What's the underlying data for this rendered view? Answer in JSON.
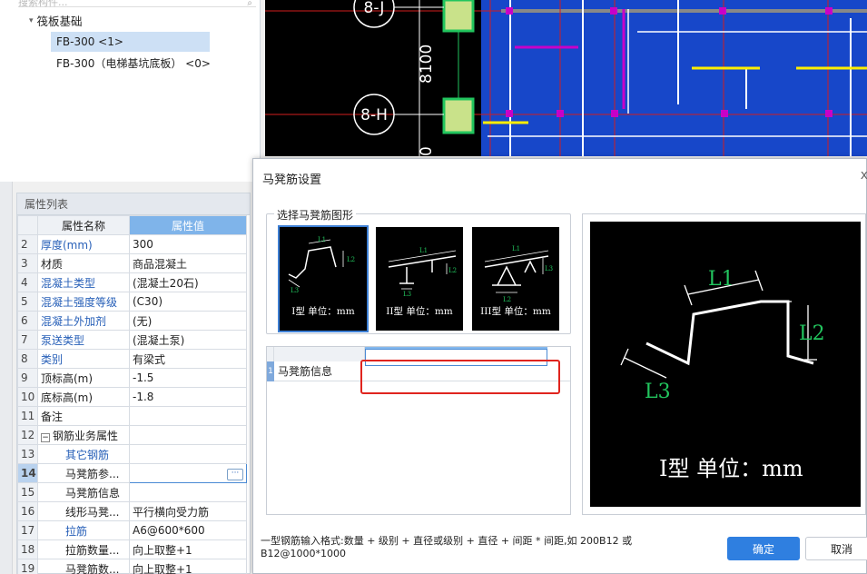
{
  "tree": {
    "search_placeholder": "搜索构件...",
    "root_label": "筏板基础",
    "nodes": [
      "FB-300 <1>",
      "FB-300（电梯基坑底板） <0>"
    ]
  },
  "props": {
    "panel_title": "属性列表",
    "col_name": "属性名称",
    "col_value": "属性值",
    "rows": [
      {
        "n": "2",
        "name": "厚度(mm)",
        "value": "300"
      },
      {
        "n": "3",
        "name": "材质",
        "value": "商品混凝土"
      },
      {
        "n": "4",
        "name": "混凝土类型",
        "value": "(混凝土20石)"
      },
      {
        "n": "5",
        "name": "混凝土强度等级",
        "value": "(C30)"
      },
      {
        "n": "6",
        "name": "混凝土外加剂",
        "value": "(无)"
      },
      {
        "n": "7",
        "name": "泵送类型",
        "value": "(混凝土泵)"
      },
      {
        "n": "8",
        "name": "类别",
        "value": "有梁式"
      },
      {
        "n": "9",
        "name": "顶标高(m)",
        "value": "-1.5"
      },
      {
        "n": "10",
        "name": "底标高(m)",
        "value": "-1.8"
      },
      {
        "n": "11",
        "name": "备注",
        "value": ""
      },
      {
        "n": "12",
        "name": "钢筋业务属性",
        "value": ""
      },
      {
        "n": "13",
        "name": "其它钢筋",
        "value": ""
      },
      {
        "n": "14",
        "name": "马凳筋参...",
        "value": ""
      },
      {
        "n": "15",
        "name": "马凳筋信息",
        "value": ""
      },
      {
        "n": "16",
        "name": "线形马凳...",
        "value": "平行横向受力筋"
      },
      {
        "n": "17",
        "name": "拉筋",
        "value": "A6@600*600"
      },
      {
        "n": "18",
        "name": "拉筋数量...",
        "value": "向上取整+1"
      },
      {
        "n": "19",
        "name": "马凳筋数...",
        "value": "向上取整+1"
      }
    ],
    "ellipsis": "···"
  },
  "cad": {
    "labels": [
      "8-J",
      "8-H"
    ],
    "dimension": "8100",
    "dimension2": "0",
    "colors": {
      "bg": "#000000",
      "slab": "#1747c9",
      "line": "#ffffff",
      "yellow": "#ffee00",
      "magenta": "#c800c8",
      "green": "#22c55e",
      "red": "#d21e1e"
    }
  },
  "dialog": {
    "title": "马凳筋设置",
    "close": "x",
    "group_label": "选择马凳筋图形",
    "shapes": [
      {
        "caption": "I型 单位：mm"
      },
      {
        "caption": "II型 单位：mm"
      },
      {
        "caption": "III型 单位：mm"
      }
    ],
    "dims": {
      "L1": "L1",
      "L2": "L2",
      "L3": "L3"
    },
    "grid_row_num": "1",
    "grid_row_label": "马凳筋信息",
    "grid_row_value": "",
    "preview_caption": "I型 单位：mm",
    "hint": "一型钢筋输入格式:数量 + 级别 + 直径或级别 + 直径 + 间距 * 间距,如 200B12 或 B12@1000*1000",
    "ok": "确定",
    "cancel": "取消"
  }
}
